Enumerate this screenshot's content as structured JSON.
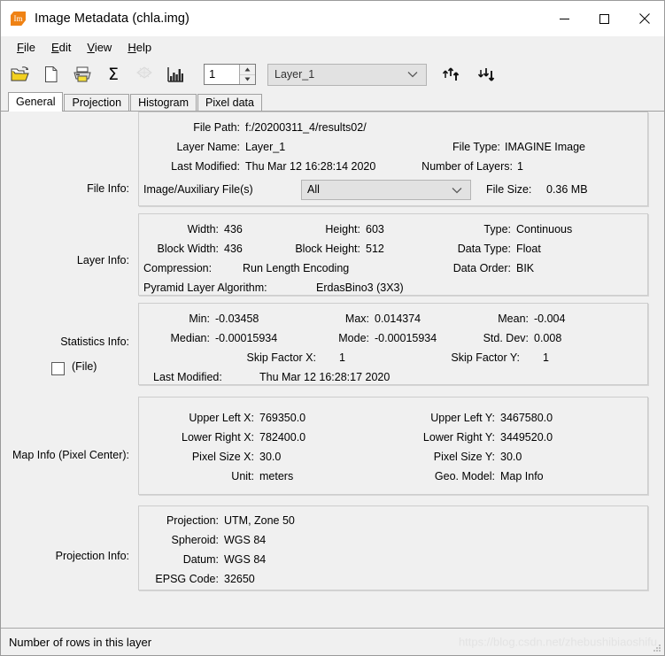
{
  "window": {
    "title": "Image Metadata (chla.img)",
    "app_icon": "image-metadata-icon",
    "icon_glyph": "Im",
    "minimize": "–",
    "maximize": "□",
    "close": "✕"
  },
  "menubar": {
    "items": [
      {
        "label": "File",
        "mnemonic": "F",
        "rest": "ile"
      },
      {
        "label": "Edit",
        "mnemonic": "E",
        "rest": "dit"
      },
      {
        "label": "View",
        "mnemonic": "V",
        "rest": "iew"
      },
      {
        "label": "Help",
        "mnemonic": "H",
        "rest": "elp"
      }
    ]
  },
  "toolbar": {
    "icons": [
      {
        "name": "open-file-icon",
        "enabled": true
      },
      {
        "name": "new-file-icon",
        "enabled": true
      },
      {
        "name": "print-icon",
        "enabled": true
      },
      {
        "name": "sigma-statistics-icon",
        "enabled": true,
        "glyph": "Σ"
      },
      {
        "name": "pyramid-layers-icon",
        "enabled": false
      },
      {
        "name": "histogram-icon",
        "enabled": true
      }
    ],
    "layer_spinner": {
      "value": "1",
      "up": "▲",
      "down": "▼"
    },
    "layer_select": {
      "value": "Layer_1"
    },
    "arrow_up_icon": "move-layer-up-icon",
    "arrow_down_icon": "move-layer-down-icon"
  },
  "tabs": [
    {
      "label": "General",
      "active": true
    },
    {
      "label": "Projection",
      "active": false
    },
    {
      "label": "Histogram",
      "active": false
    },
    {
      "label": "Pixel data",
      "active": false
    }
  ],
  "sections": {
    "file_info": {
      "label": "File Info:",
      "file_path_label": "File Path:",
      "file_path_value": "f:/20200311_4/results02/",
      "layer_name_label": "Layer Name:",
      "layer_name_value": "Layer_1",
      "file_type_label": "File Type:",
      "file_type_value": "IMAGINE Image",
      "last_modified_label": "Last Modified:",
      "last_modified_value": "Thu Mar 12 16:28:14 2020",
      "number_of_layers_label": "Number of Layers:",
      "number_of_layers_value": "1",
      "aux_files_label": "Image/Auxiliary File(s)",
      "aux_files_value": "All",
      "file_size_label": "File Size:",
      "file_size_value": "0.36 MB"
    },
    "layer_info": {
      "label": "Layer Info:",
      "width_label": "Width:",
      "width_value": "436",
      "height_label": "Height:",
      "height_value": "603",
      "type_label": "Type:",
      "type_value": "Continuous",
      "block_width_label": "Block Width:",
      "block_width_value": "436",
      "block_height_label": "Block Height:",
      "block_height_value": "512",
      "data_type_label": "Data Type:",
      "data_type_value": "Float",
      "compression_label": "Compression:",
      "compression_value": "Run Length Encoding",
      "data_order_label": "Data Order:",
      "data_order_value": "BIK",
      "pyramid_label": "Pyramid Layer Algorithm:",
      "pyramid_value": "ErdasBino3 (3X3)"
    },
    "statistics_info": {
      "label": "Statistics Info:",
      "file_checkbox_label": "(File)",
      "file_checkbox_checked": false,
      "min_label": "Min:",
      "min_value": "-0.03458",
      "max_label": "Max:",
      "max_value": "0.014374",
      "mean_label": "Mean:",
      "mean_value": "-0.004",
      "median_label": "Median:",
      "median_value": "-0.00015934",
      "mode_label": "Mode:",
      "mode_value": "-0.00015934",
      "stddev_label": "Std. Dev:",
      "stddev_value": "0.008",
      "skip_x_label": "Skip Factor X:",
      "skip_x_value": "1",
      "skip_y_label": "Skip Factor Y:",
      "skip_y_value": "1",
      "last_modified_label": "Last Modified:",
      "last_modified_value": "Thu Mar 12 16:28:17 2020"
    },
    "map_info": {
      "label": "Map Info (Pixel Center):",
      "ulx_label": "Upper Left X:",
      "ulx_value": "769350.0",
      "uly_label": "Upper Left Y:",
      "uly_value": "3467580.0",
      "lrx_label": "Lower Right X:",
      "lrx_value": "782400.0",
      "lry_label": "Lower Right Y:",
      "lry_value": "3449520.0",
      "psx_label": "Pixel Size X:",
      "psx_value": "30.0",
      "psy_label": "Pixel Size Y:",
      "psy_value": "30.0",
      "unit_label": "Unit:",
      "unit_value": "meters",
      "geo_model_label": "Geo. Model:",
      "geo_model_value": "Map Info"
    },
    "projection_info": {
      "label": "Projection Info:",
      "projection_label": "Projection:",
      "projection_value": "UTM, Zone 50",
      "spheroid_label": "Spheroid:",
      "spheroid_value": "WGS 84",
      "datum_label": "Datum:",
      "datum_value": "WGS 84",
      "epsg_label": "EPSG Code:",
      "epsg_value": "32650"
    }
  },
  "statusbar": {
    "text": "Number of rows in this layer",
    "watermark": "https://blog.csdn.net/zhebushibiaoshifu"
  },
  "colors": {
    "accent_orange": "#ef8214",
    "window_bg": "#f0f0f0",
    "panel_border": "#cdcdcd",
    "titlebar_bg": "#ffffff"
  }
}
